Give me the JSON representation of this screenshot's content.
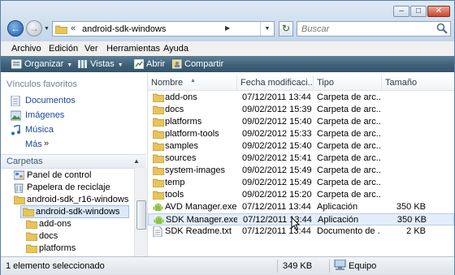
{
  "address": {
    "path": "android-sdk-windows"
  },
  "search": {
    "placeholder": "Buscar"
  },
  "menu": [
    "Archivo",
    "Edición",
    "Ver",
    "Herramientas",
    "Ayuda"
  ],
  "toolbar": {
    "organize": "Organizar",
    "views": "Vistas",
    "open": "Abrir",
    "share": "Compartir"
  },
  "nav": {
    "favorites_header": "Vínculos favoritos",
    "favorites": [
      "Documentos",
      "Imágenes",
      "Música"
    ],
    "more": "Más",
    "folders_header": "Carpetas",
    "tree": [
      "Panel de control",
      "Papelera de reciclaje",
      "android-sdk_r16-windows",
      "android-sdk-windows",
      "add-ons",
      "docs",
      "platforms"
    ]
  },
  "columns": {
    "name": "Nombre",
    "date": "Fecha modificaci...",
    "type": "Tipo",
    "size": "Tamaño"
  },
  "files": [
    {
      "name": "add-ons",
      "date": "07/12/2011 13:44",
      "type": "Carpeta de arc...",
      "size": "",
      "icon": "folder-icon"
    },
    {
      "name": "docs",
      "date": "09/02/2012 15:39",
      "type": "Carpeta de arc...",
      "size": "",
      "icon": "folder-icon"
    },
    {
      "name": "platforms",
      "date": "09/02/2012 15:40",
      "type": "Carpeta de arc...",
      "size": "",
      "icon": "folder-icon"
    },
    {
      "name": "platform-tools",
      "date": "09/02/2012 15:33",
      "type": "Carpeta de arc...",
      "size": "",
      "icon": "folder-icon"
    },
    {
      "name": "samples",
      "date": "09/02/2012 15:40",
      "type": "Carpeta de arc...",
      "size": "",
      "icon": "folder-icon"
    },
    {
      "name": "sources",
      "date": "09/02/2012 15:41",
      "type": "Carpeta de arc...",
      "size": "",
      "icon": "folder-icon"
    },
    {
      "name": "system-images",
      "date": "09/02/2012 15:49",
      "type": "Carpeta de arc...",
      "size": "",
      "icon": "folder-icon"
    },
    {
      "name": "temp",
      "date": "09/02/2012 15:49",
      "type": "Carpeta de arc...",
      "size": "",
      "icon": "folder-icon"
    },
    {
      "name": "tools",
      "date": "09/02/2012 15:20",
      "type": "Carpeta de arc...",
      "size": "",
      "icon": "folder-icon"
    },
    {
      "name": "AVD Manager.exe",
      "date": "07/12/2011 13:44",
      "type": "Aplicación",
      "size": "350 KB",
      "icon": "android-app-icon"
    },
    {
      "name": "SDK Manager.exe",
      "date": "07/12/2011 13:44",
      "type": "Aplicación",
      "size": "350 KB",
      "icon": "android-app-icon"
    },
    {
      "name": "SDK Readme.txt",
      "date": "07/12/2011 13:44",
      "type": "Documento de ...",
      "size": "2 KB",
      "icon": "text-file-icon"
    }
  ],
  "status": {
    "selection": "1 elemento seleccionado",
    "size": "349 KB",
    "location": "Equipo"
  },
  "colors": {
    "folder": "#e8c45a",
    "selection": "#e3eefa",
    "command_bar": "#3f6178"
  }
}
